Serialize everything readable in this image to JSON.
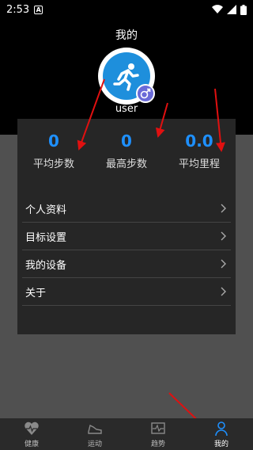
{
  "status": {
    "time": "2:53",
    "notification": "A"
  },
  "header": {
    "title": "我的",
    "username": "user"
  },
  "stats": [
    {
      "value": "0",
      "label": "平均步数"
    },
    {
      "value": "0",
      "label": "最高步数"
    },
    {
      "value": "0.0",
      "label": "平均里程"
    }
  ],
  "menu": [
    {
      "label": "个人资料"
    },
    {
      "label": "目标设置"
    },
    {
      "label": "我的设备"
    },
    {
      "label": "关于"
    }
  ],
  "tabs": [
    {
      "label": "健康",
      "icon": "heart-icon"
    },
    {
      "label": "运动",
      "icon": "shoe-icon"
    },
    {
      "label": "趋势",
      "icon": "trend-icon"
    },
    {
      "label": "我的",
      "icon": "person-icon",
      "active": true
    }
  ],
  "colors": {
    "accent": "#1e90ff",
    "annotation": "#e01010"
  }
}
